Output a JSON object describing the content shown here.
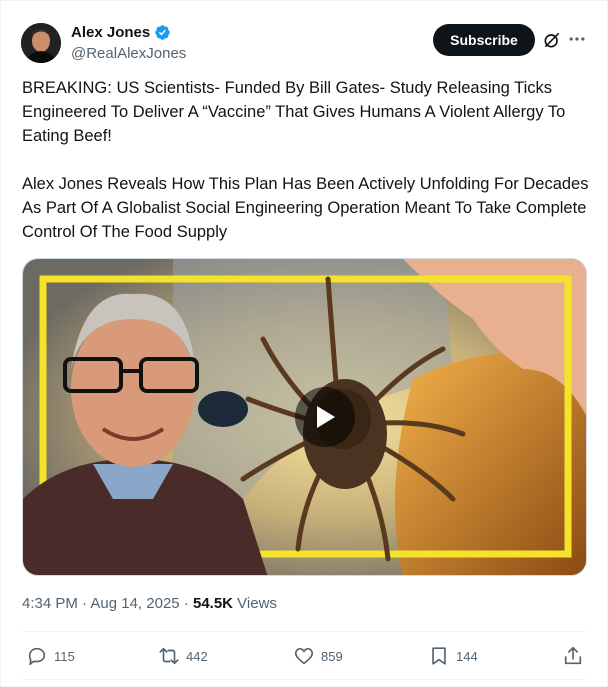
{
  "author": {
    "display_name": "Alex Jones",
    "handle": "@RealAlexJones"
  },
  "header": {
    "subscribe_label": "Subscribe"
  },
  "tweet": {
    "paragraphs": [
      "BREAKING: US Scientists- Funded By Bill Gates- Study Releasing Ticks Engineered To Deliver A “Vaccine” That Gives Humans A Violent Allergy To Eating Beef!",
      "Alex Jones Reveals How This Plan Has Been Actively Unfolding For Decades As Part Of A Globalist Social Engineering Operation Meant To Take Complete Control Of The Food Supply"
    ]
  },
  "meta": {
    "time": "4:34 PM",
    "separator1": " · ",
    "date": "Aug 14, 2025",
    "separator2": " · ",
    "views_count": "54.5K",
    "views_label": " Views"
  },
  "actions": {
    "replies": "115",
    "reposts": "442",
    "likes": "859",
    "bookmarks": "144"
  },
  "colors": {
    "verified": "#1d9bf0",
    "text_secondary": "#536471",
    "frame_yellow": "#f5e22a"
  }
}
